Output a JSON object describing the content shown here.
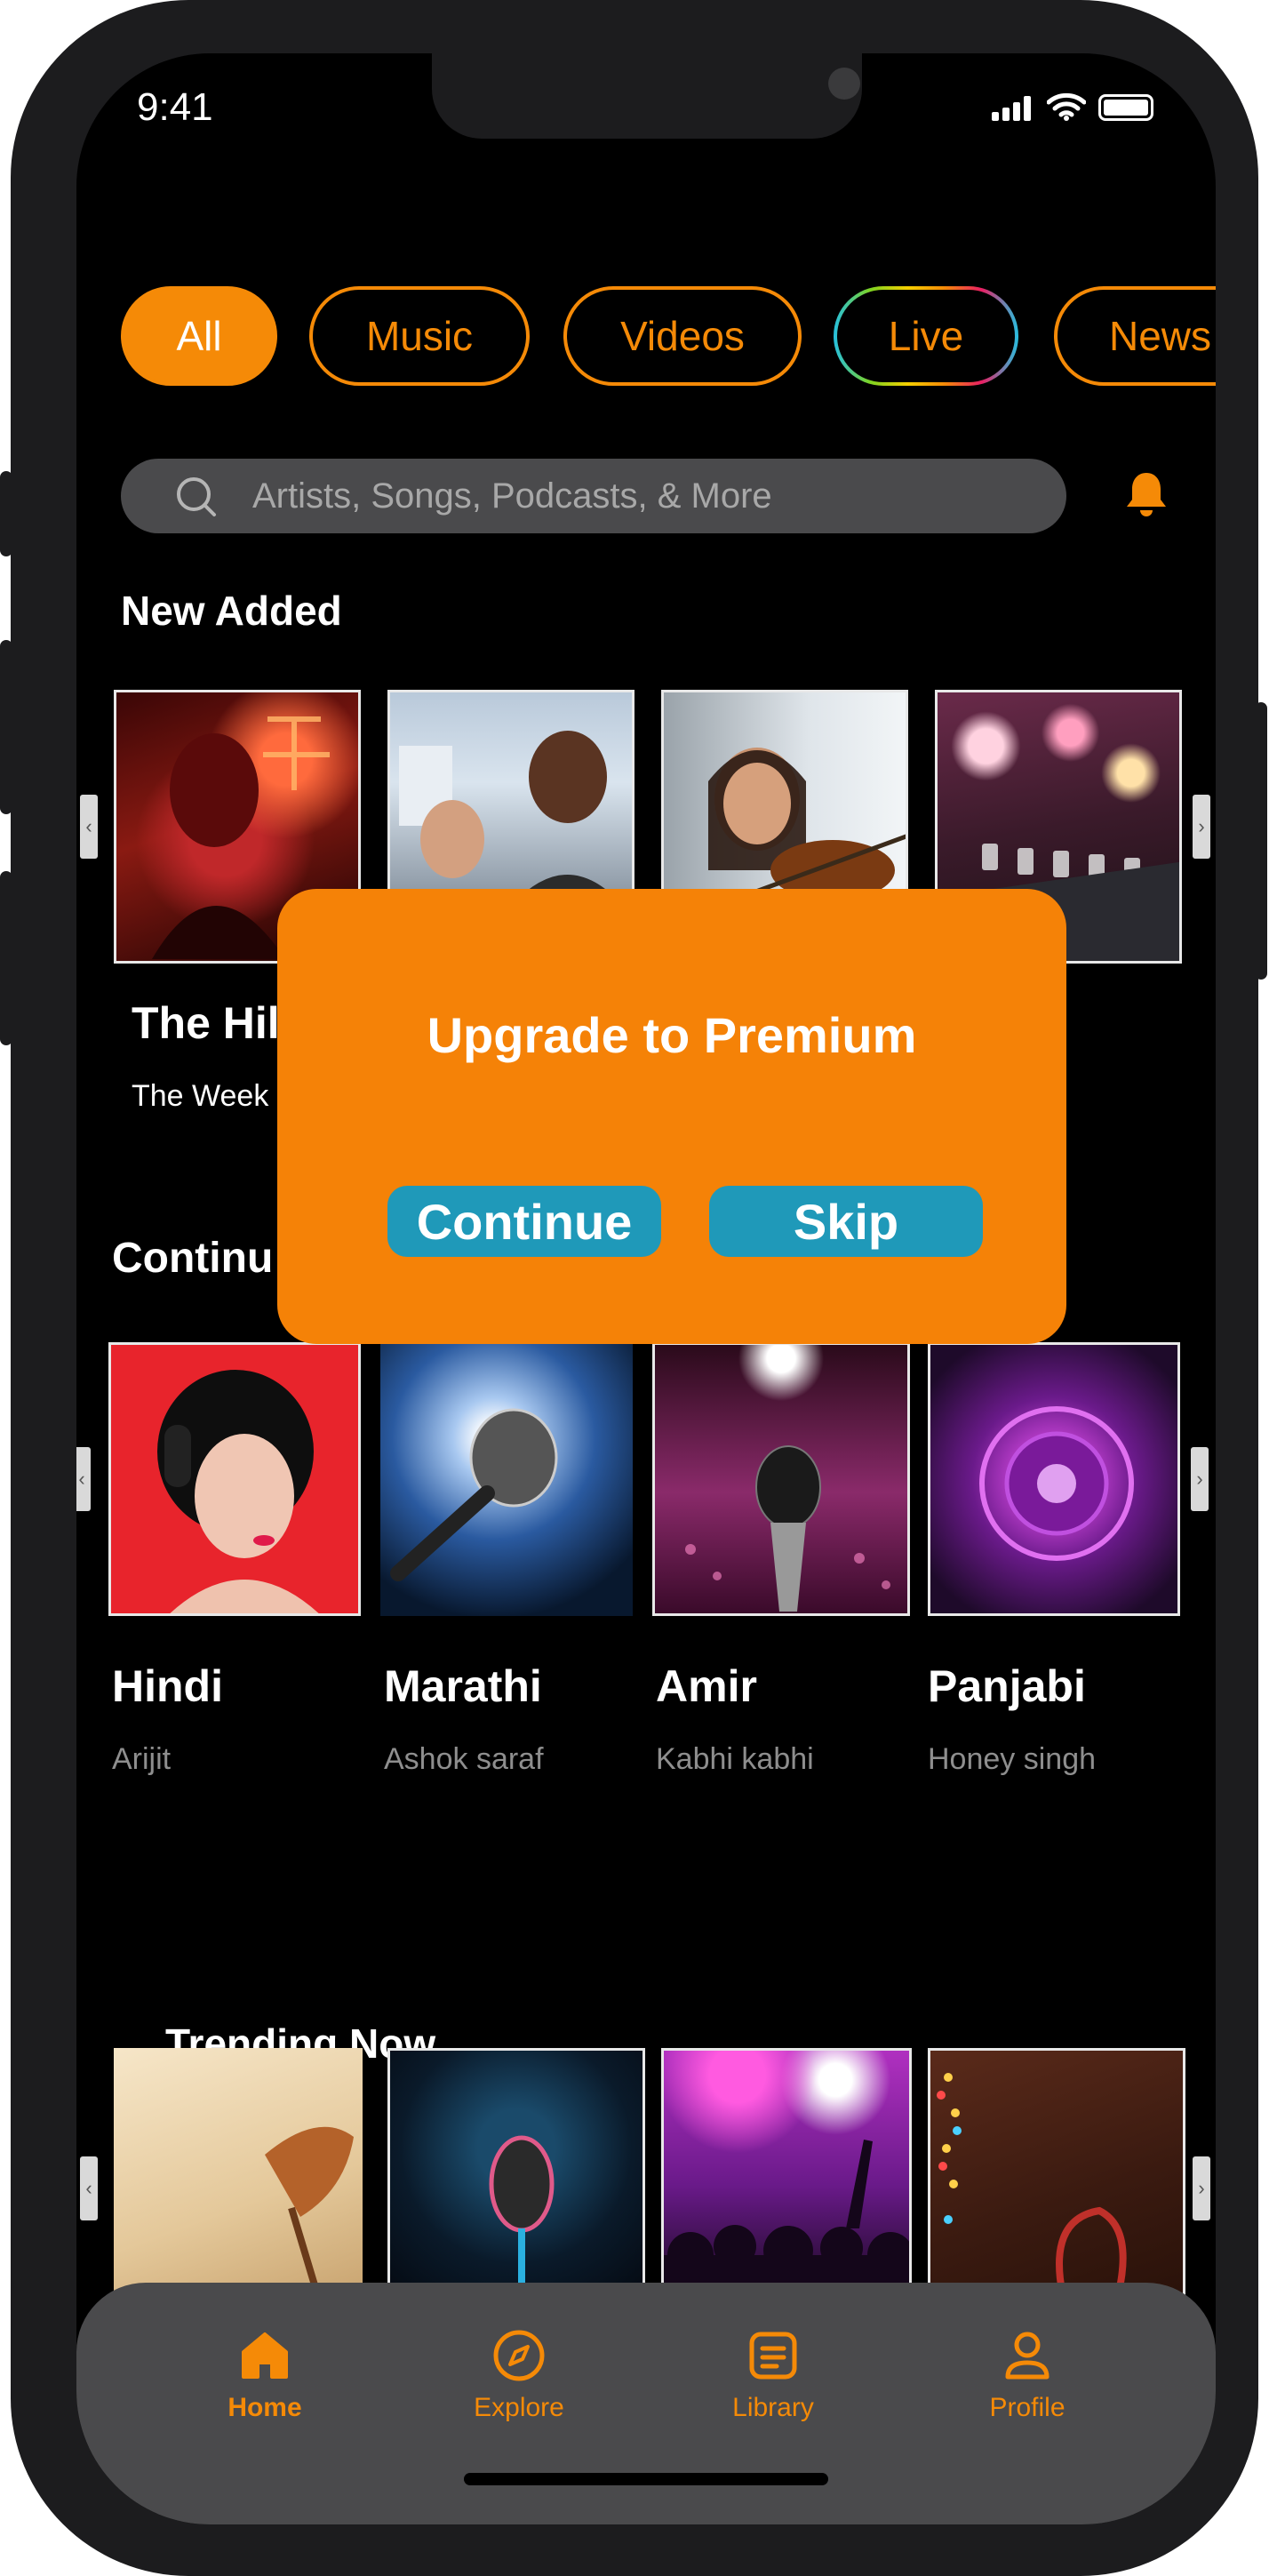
{
  "status": {
    "time": "9:41"
  },
  "filters": [
    {
      "label": "All",
      "active": true
    },
    {
      "label": "Music"
    },
    {
      "label": "Videos"
    },
    {
      "label": "Live"
    },
    {
      "label": "News"
    }
  ],
  "search": {
    "placeholder": "Artists, Songs, Podcasts, & More"
  },
  "new_added": {
    "title": "New Added",
    "cards": [
      {
        "title": "The Hil",
        "subtitle": "The Week"
      }
    ]
  },
  "continue": {
    "title": "Continu",
    "cards": [
      {
        "title": "Hindi",
        "subtitle": "Arijit"
      },
      {
        "title": "Marathi",
        "subtitle": "Ashok saraf"
      },
      {
        "title": "Amir",
        "subtitle": "Kabhi kabhi"
      },
      {
        "title": "Panjabi",
        "subtitle": "Honey singh"
      }
    ]
  },
  "trending": {
    "title": "Trending Now"
  },
  "modal": {
    "title": "Upgrade to Premium",
    "continue_label": "Continue",
    "skip_label": "Skip"
  },
  "tabs": [
    {
      "label": "Home",
      "active": true
    },
    {
      "label": "Explore"
    },
    {
      "label": "Library"
    },
    {
      "label": "Profile"
    }
  ],
  "colors": {
    "accent": "#F58A07",
    "modal": "#F58207",
    "button": "#1F99B9",
    "tabbar": "#4A4A4C"
  }
}
